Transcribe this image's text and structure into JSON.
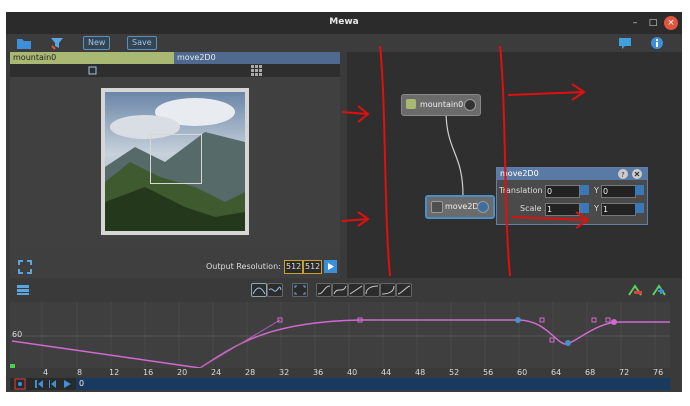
{
  "window": {
    "title": "Mewa"
  },
  "toolbar": {
    "new_label": "New",
    "save_label": "Save"
  },
  "tabs": [
    {
      "label": "mountain0"
    },
    {
      "label": "move2D0"
    }
  ],
  "viewer": {
    "output_resolution_label": "Output Resolution:",
    "width": "512",
    "height": "512"
  },
  "nodes": [
    {
      "label": "mountain0"
    },
    {
      "label": "move2D0"
    }
  ],
  "panel": {
    "title": "move2D0",
    "translation_label": "Translation X",
    "translation_x": "0",
    "translation_y_label": "Y",
    "translation_y": "0",
    "scale_label": "Scale X",
    "scale_x": "1",
    "scale_y_label": "Y",
    "scale_y": "1"
  },
  "timeline": {
    "y_tick": "60",
    "x_ticks": [
      "4",
      "8",
      "12",
      "16",
      "20",
      "24",
      "28",
      "32",
      "36",
      "40",
      "44",
      "48",
      "52",
      "56",
      "60",
      "64",
      "68",
      "72",
      "76"
    ],
    "current_frame": "0"
  },
  "colors": {
    "accent": "#4a90c8",
    "curve": "#d06ad0",
    "annotation": "#e01010",
    "node_mountain": "#a9b873",
    "node_move": "#4f6a8e"
  }
}
